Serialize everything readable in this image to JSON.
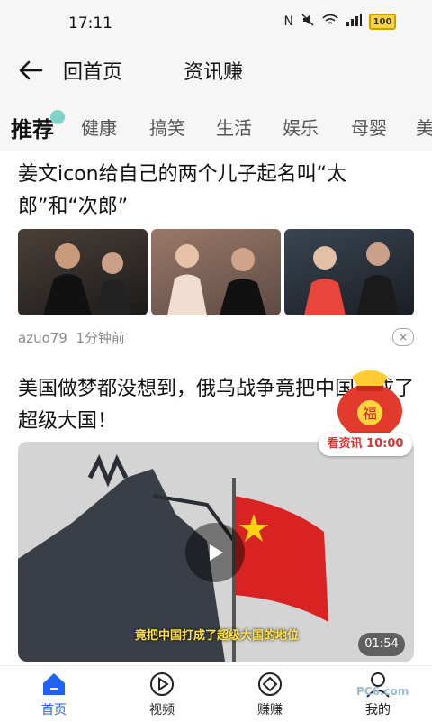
{
  "statusbar": {
    "time": "17:11",
    "battery": "100"
  },
  "header": {
    "home": "回首页",
    "title": "资讯赚"
  },
  "tabs": [
    {
      "label": "推荐"
    },
    {
      "label": "健康"
    },
    {
      "label": "搞笑"
    },
    {
      "label": "生活"
    },
    {
      "label": "娱乐"
    },
    {
      "label": "母婴"
    },
    {
      "label": "美"
    }
  ],
  "article1": {
    "title": "姜文icon给自己的两个儿子起名叫“太郎”和“次郎”",
    "author": "azuo79",
    "time": "1分钟前",
    "close": "×"
  },
  "article2": {
    "title": "美国做梦都没想到，俄乌战争竟把中国打成了超级大国！",
    "subtitle": "竟把中国打成了超级大国的地位",
    "duration": "01:54"
  },
  "reward": {
    "label": "看资讯 10:00",
    "bag_text": "福"
  },
  "bottomnav": [
    {
      "label": "首页"
    },
    {
      "label": "视频"
    },
    {
      "label": "赚赚"
    },
    {
      "label": "我的"
    }
  ],
  "watermark": "PC6.com",
  "colors": {
    "accent": "#1e63f0",
    "reward": "#d33333"
  }
}
